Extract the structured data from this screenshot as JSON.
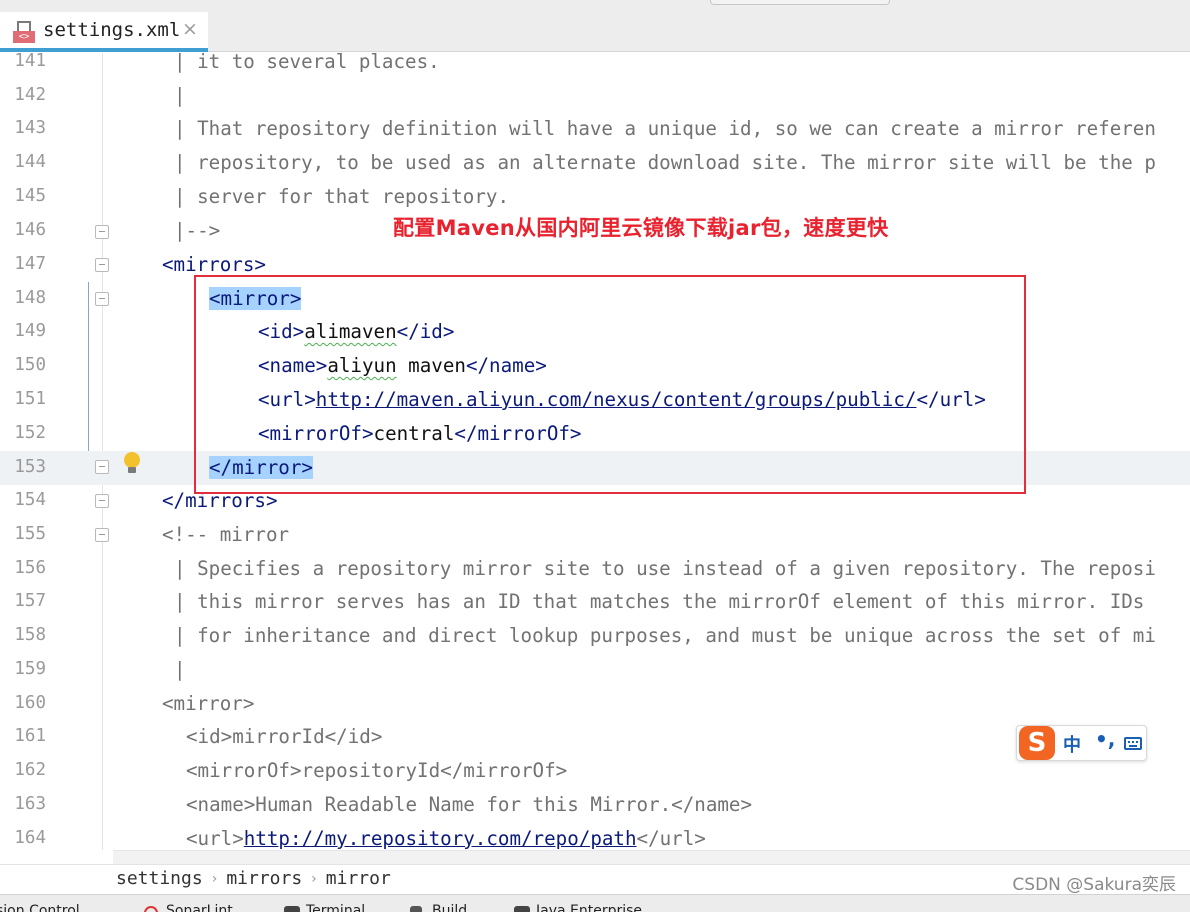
{
  "tab": {
    "filename": "settings.xml",
    "badge": "<>",
    "close": "×"
  },
  "lines": [
    {
      "n": "141",
      "t": "| it to several places."
    },
    {
      "n": "142",
      "t": "|"
    },
    {
      "n": "143",
      "t": "| That repository definition will have a unique id, so we can create a mirror referen"
    },
    {
      "n": "144",
      "t": "| repository, to be used as an alternate download site. The mirror site will be the p"
    },
    {
      "n": "145",
      "t": "| server for that repository."
    },
    {
      "n": "146",
      "t": "|-->"
    },
    {
      "n": "147",
      "t": "<mirrors>"
    },
    {
      "n": "148",
      "t": "<mirror>"
    },
    {
      "n": "149",
      "t": "<id>",
      "v": "alimaven",
      "e": "</id>"
    },
    {
      "n": "150",
      "t": "<name>",
      "v": "aliyun",
      "v2": " maven",
      "e": "</name>"
    },
    {
      "n": "151",
      "t": "<url>",
      "v": "http://maven.aliyun.com/nexus/content/groups/public/",
      "e": "</url>"
    },
    {
      "n": "152",
      "t": "<mirrorOf>",
      "v": "central",
      "e": "</mirrorOf>"
    },
    {
      "n": "153",
      "t": "</mirror>"
    },
    {
      "n": "154",
      "t": "</mirrors>"
    },
    {
      "n": "155",
      "t": "<!-- mirror"
    },
    {
      "n": "156",
      "t": "| Specifies a repository mirror site to use instead of a given repository. The reposi"
    },
    {
      "n": "157",
      "t": "| this mirror serves has an ID that matches the mirrorOf element of this mirror. IDs "
    },
    {
      "n": "158",
      "t": "| for inheritance and direct lookup purposes, and must be unique across the set of mi"
    },
    {
      "n": "159",
      "t": "|"
    },
    {
      "n": "160",
      "t": "<mirror>"
    },
    {
      "n": "161",
      "t": "<id>mirrorId</id>"
    },
    {
      "n": "162",
      "t": "<mirrorOf>repositoryId</mirrorOf>"
    },
    {
      "n": "163",
      "t": "<name>Human Readable Name for this Mirror.</name>"
    },
    {
      "n": "164",
      "t": "<url>",
      "v": "http://my.repository.com/repo/path",
      "e": "</url>"
    }
  ],
  "annotation": "配置Maven从国内阿里云镜像下载jar包，速度更快",
  "breadcrumb": [
    "settings",
    "mirrors",
    "mirror"
  ],
  "watermark": "CSDN @Sakura奕辰",
  "ime": {
    "logo": "S",
    "mode": "中",
    "punct": "•,"
  },
  "toolwindows": [
    "sion Control",
    "SonarLint",
    "Terminal",
    "Build",
    "Java Enterprise"
  ],
  "colors": {
    "accent": "#3f9fd1",
    "annotation": "#e8222e",
    "selection": "#a6d2ff",
    "tag": "#0b1a7a"
  }
}
